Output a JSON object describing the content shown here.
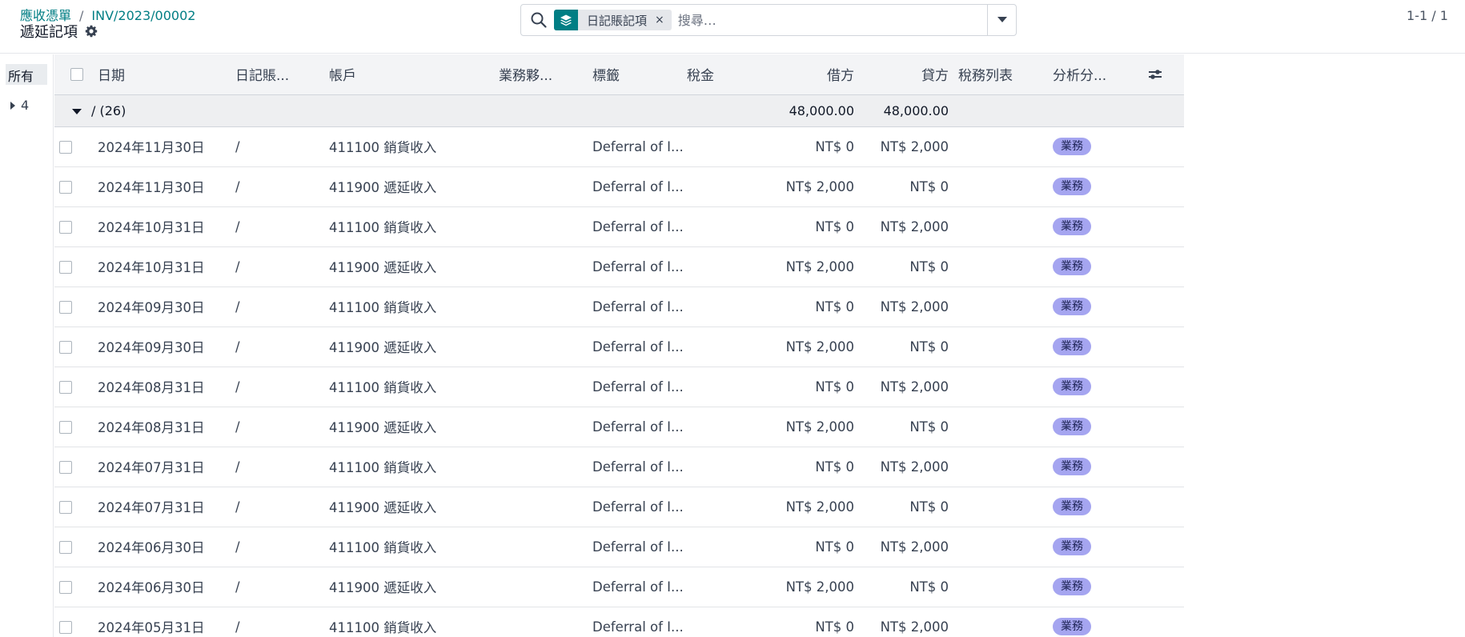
{
  "breadcrumb": {
    "parent": "應收憑單",
    "separator": "/",
    "current": "INV/2023/00002"
  },
  "page": {
    "title": "遞延記項"
  },
  "search": {
    "facet_label": "日記賬記項",
    "facet_remove": "×",
    "placeholder": "搜尋…"
  },
  "pager": {
    "text": "1-1 / 1"
  },
  "search_panel": {
    "all_label": "所有",
    "item_label": "4"
  },
  "columns": {
    "date": "日期",
    "journal": "日記賬...",
    "account": "帳戶",
    "partner": "業務夥...",
    "label": "標籤",
    "tax": "稅金",
    "debit": "借方",
    "credit": "貸方",
    "tax_grids": "稅務列表",
    "analytic": "分析分..."
  },
  "group": {
    "label": "/ (26)",
    "debit_total": "48,000.00",
    "credit_total": "48,000.00"
  },
  "rows": [
    {
      "date": "2024年11月30日",
      "journal": "/",
      "account": "411100 銷貨收入",
      "label": "Deferral of I...",
      "debit": "NT$ 0",
      "credit": "NT$ 2,000",
      "tag": "業務"
    },
    {
      "date": "2024年11月30日",
      "journal": "/",
      "account": "411900 遞延收入",
      "label": "Deferral of I...",
      "debit": "NT$ 2,000",
      "credit": "NT$ 0",
      "tag": "業務"
    },
    {
      "date": "2024年10月31日",
      "journal": "/",
      "account": "411100 銷貨收入",
      "label": "Deferral of I...",
      "debit": "NT$ 0",
      "credit": "NT$ 2,000",
      "tag": "業務"
    },
    {
      "date": "2024年10月31日",
      "journal": "/",
      "account": "411900 遞延收入",
      "label": "Deferral of I...",
      "debit": "NT$ 2,000",
      "credit": "NT$ 0",
      "tag": "業務"
    },
    {
      "date": "2024年09月30日",
      "journal": "/",
      "account": "411100 銷貨收入",
      "label": "Deferral of I...",
      "debit": "NT$ 0",
      "credit": "NT$ 2,000",
      "tag": "業務"
    },
    {
      "date": "2024年09月30日",
      "journal": "/",
      "account": "411900 遞延收入",
      "label": "Deferral of I...",
      "debit": "NT$ 2,000",
      "credit": "NT$ 0",
      "tag": "業務"
    },
    {
      "date": "2024年08月31日",
      "journal": "/",
      "account": "411100 銷貨收入",
      "label": "Deferral of I...",
      "debit": "NT$ 0",
      "credit": "NT$ 2,000",
      "tag": "業務"
    },
    {
      "date": "2024年08月31日",
      "journal": "/",
      "account": "411900 遞延收入",
      "label": "Deferral of I...",
      "debit": "NT$ 2,000",
      "credit": "NT$ 0",
      "tag": "業務"
    },
    {
      "date": "2024年07月31日",
      "journal": "/",
      "account": "411100 銷貨收入",
      "label": "Deferral of I...",
      "debit": "NT$ 0",
      "credit": "NT$ 2,000",
      "tag": "業務"
    },
    {
      "date": "2024年07月31日",
      "journal": "/",
      "account": "411900 遞延收入",
      "label": "Deferral of I...",
      "debit": "NT$ 2,000",
      "credit": "NT$ 0",
      "tag": "業務"
    },
    {
      "date": "2024年06月30日",
      "journal": "/",
      "account": "411100 銷貨收入",
      "label": "Deferral of I...",
      "debit": "NT$ 0",
      "credit": "NT$ 2,000",
      "tag": "業務"
    },
    {
      "date": "2024年06月30日",
      "journal": "/",
      "account": "411900 遞延收入",
      "label": "Deferral of I...",
      "debit": "NT$ 2,000",
      "credit": "NT$ 0",
      "tag": "業務"
    },
    {
      "date": "2024年05月31日",
      "journal": "/",
      "account": "411100 銷貨收入",
      "label": "Deferral of I...",
      "debit": "NT$ 0",
      "credit": "NT$ 2,000",
      "tag": "業務"
    }
  ],
  "colors": {
    "accent": "#017e84",
    "tag_bg": "#a5a5f0",
    "header_bg": "#f3f4f6"
  },
  "icons": {
    "search": "search-icon",
    "facet": "layers-icon",
    "settings": "gear-icon",
    "toggle": "caret-down-icon",
    "optional_columns": "sliders-icon"
  }
}
